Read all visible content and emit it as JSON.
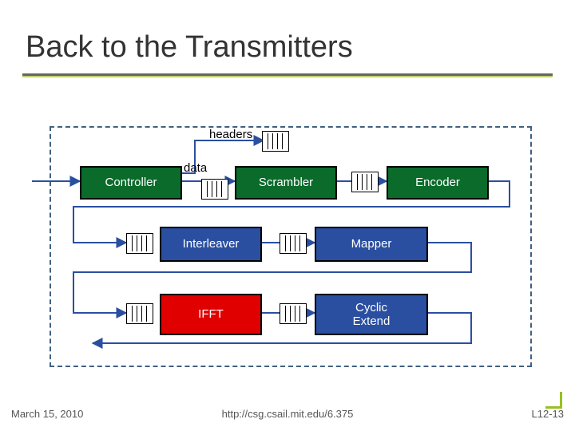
{
  "slide": {
    "title": "Back to the Transmitters",
    "date": "March 15, 2010",
    "url": "http://csg.csail.mit.edu/6.375",
    "page": "L12-13"
  },
  "labels": {
    "headers": "headers",
    "data": "data"
  },
  "blocks": {
    "controller": "Controller",
    "scrambler": "Scrambler",
    "encoder": "Encoder",
    "interleaver": "Interleaver",
    "mapper": "Mapper",
    "ifft": "IFFT",
    "cyclic": "Cyclic\nExtend"
  },
  "chart_data": {
    "type": "diagram",
    "title": "Back to the Transmitters",
    "nodes": [
      {
        "id": "controller",
        "label": "Controller",
        "kind": "stage",
        "color": "green"
      },
      {
        "id": "scrambler",
        "label": "Scrambler",
        "kind": "stage",
        "color": "green"
      },
      {
        "id": "encoder",
        "label": "Encoder",
        "kind": "stage",
        "color": "green"
      },
      {
        "id": "interleaver",
        "label": "Interleaver",
        "kind": "stage",
        "color": "blue"
      },
      {
        "id": "mapper",
        "label": "Mapper",
        "kind": "stage",
        "color": "blue"
      },
      {
        "id": "ifft",
        "label": "IFFT",
        "kind": "stage",
        "color": "red"
      },
      {
        "id": "cyclic",
        "label": "Cyclic Extend",
        "kind": "stage",
        "color": "blue"
      }
    ],
    "edges": [
      {
        "from": "input",
        "to": "controller"
      },
      {
        "from": "controller",
        "to": "scrambler",
        "label": "data",
        "buffer": true
      },
      {
        "from": "controller",
        "to": "merge",
        "label": "headers",
        "buffer": true
      },
      {
        "from": "scrambler",
        "to": "encoder",
        "buffer": true
      },
      {
        "from": "encoder",
        "to": "interleaver",
        "wrap": true,
        "buffer": true
      },
      {
        "from": "interleaver",
        "to": "mapper",
        "buffer": true
      },
      {
        "from": "mapper",
        "to": "ifft",
        "wrap": true,
        "buffer": true
      },
      {
        "from": "ifft",
        "to": "cyclic",
        "buffer": true
      },
      {
        "from": "cyclic",
        "to": "output",
        "wrap": true
      }
    ],
    "container": "dashed-frame"
  }
}
